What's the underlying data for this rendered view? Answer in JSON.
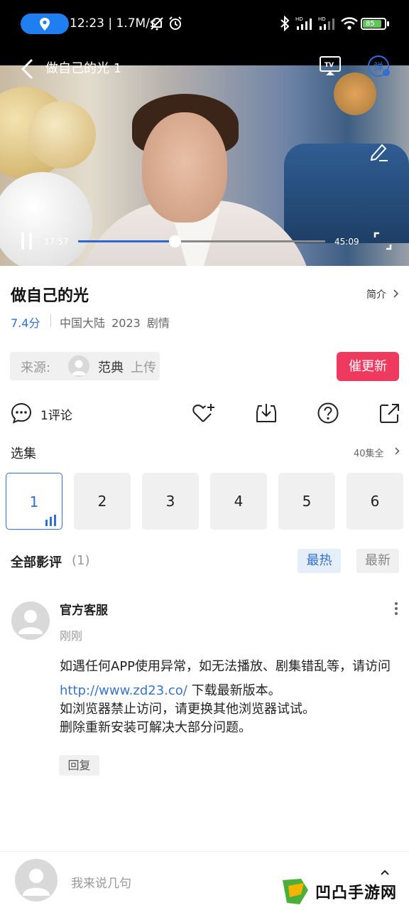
{
  "status_bar": {
    "time_speed": "12:23 | 1.7M/s",
    "battery": "85",
    "colors": {
      "location_pill": "#1f7ff0",
      "battery_fill": "#62c45b"
    }
  },
  "player": {
    "title": "做自己的光 1",
    "current_time": "17:57",
    "total_time": "45:09",
    "progress": 0.39,
    "icons": [
      "back-icon",
      "tv-cast-icon",
      "danmaku-icon",
      "pen-icon",
      "pause-icon",
      "fullscreen-icon"
    ]
  },
  "info": {
    "title": "做自己的光",
    "intro_label": "简介",
    "score": "7.4分",
    "meta": "中国大陆 2023 剧情",
    "source_label": "来源:",
    "uploader": "范典",
    "upload_suffix": "上传",
    "urge_button": "催更新"
  },
  "actions": {
    "comments": "1评论"
  },
  "episodes": {
    "title": "选集",
    "all_label": "40集全",
    "items": [
      "1",
      "2",
      "3",
      "4",
      "5",
      "6"
    ],
    "active_index": 0
  },
  "reviews": {
    "title": "全部影评",
    "count": "(1)",
    "sort_hot": "最热",
    "sort_new": "最新",
    "comment": {
      "author": "官方客服",
      "time": "刚刚",
      "line1": "如遇任何APP使用异常，如无法播放、剧集错乱等，请访问",
      "link": "http://www.zd23.co/",
      "line2_after_link": " 下载最新版本。",
      "line3": "如浏览器禁止访问，请更换其他浏览器试试。",
      "line4": "删除重新安装可解决大部分问题。",
      "reply_label": "回复"
    }
  },
  "bottom": {
    "input_placeholder": "我来说几句",
    "watermark": "凹凸手游网"
  },
  "colors": {
    "accent_blue": "#2f6fd6",
    "urge_red": "#ee3a5f"
  }
}
